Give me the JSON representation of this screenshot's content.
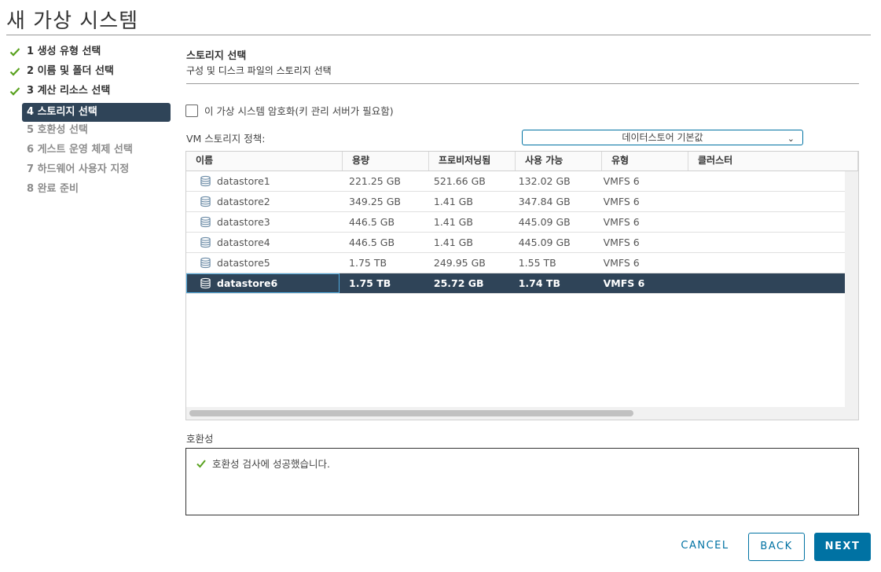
{
  "window": {
    "title": "새 가상 시스템"
  },
  "steps": [
    {
      "label": "1 생성 유형 선택",
      "state": "done"
    },
    {
      "label": "2 이름 및 폴더 선택",
      "state": "done"
    },
    {
      "label": "3 계산 리소스 선택",
      "state": "done"
    },
    {
      "label": "4 스토리지 선택",
      "state": "active"
    },
    {
      "label": "5 호환성 선택",
      "state": "todo"
    },
    {
      "label": "6 게스트 운영 체제 선택",
      "state": "todo"
    },
    {
      "label": "7 하드웨어 사용자 지정",
      "state": "todo"
    },
    {
      "label": "8 완료 준비",
      "state": "todo"
    }
  ],
  "section": {
    "title": "스토리지 선택",
    "subtitle": "구성 및 디스크 파일의 스토리지 선택"
  },
  "encrypt": {
    "label": "이 가상 시스템 암호화(키 관리 서버가 필요함)",
    "checked": false
  },
  "policy": {
    "label": "VM 스토리지 정책:",
    "value": "데이터스토어 기본값"
  },
  "table": {
    "columns": [
      "이름",
      "용량",
      "프로비저닝됨",
      "사용 가능",
      "유형",
      "클러스터"
    ],
    "rows": [
      {
        "name": "datastore1",
        "capacity": "221.25 GB",
        "provisioned": "521.66 GB",
        "free": "132.02 GB",
        "type": "VMFS 6",
        "cluster": ""
      },
      {
        "name": "datastore2",
        "capacity": "349.25 GB",
        "provisioned": "1.41 GB",
        "free": "347.84 GB",
        "type": "VMFS 6",
        "cluster": ""
      },
      {
        "name": "datastore3",
        "capacity": "446.5 GB",
        "provisioned": "1.41 GB",
        "free": "445.09 GB",
        "type": "VMFS 6",
        "cluster": ""
      },
      {
        "name": "datastore4",
        "capacity": "446.5 GB",
        "provisioned": "1.41 GB",
        "free": "445.09 GB",
        "type": "VMFS 6",
        "cluster": ""
      },
      {
        "name": "datastore5",
        "capacity": "1.75 TB",
        "provisioned": "249.95 GB",
        "free": "1.55 TB",
        "type": "VMFS 6",
        "cluster": ""
      },
      {
        "name": "datastore6",
        "capacity": "1.75 TB",
        "provisioned": "25.72 GB",
        "free": "1.74 TB",
        "type": "VMFS 6",
        "cluster": "",
        "selected": true
      }
    ]
  },
  "compat": {
    "label": "호환성",
    "message": "호환성 검사에 성공했습니다."
  },
  "buttons": {
    "cancel": "CANCEL",
    "back": "BACK",
    "next": "NEXT"
  },
  "colors": {
    "accent": "#0072a3",
    "selected": "#2f4458",
    "success": "#5aa220"
  }
}
